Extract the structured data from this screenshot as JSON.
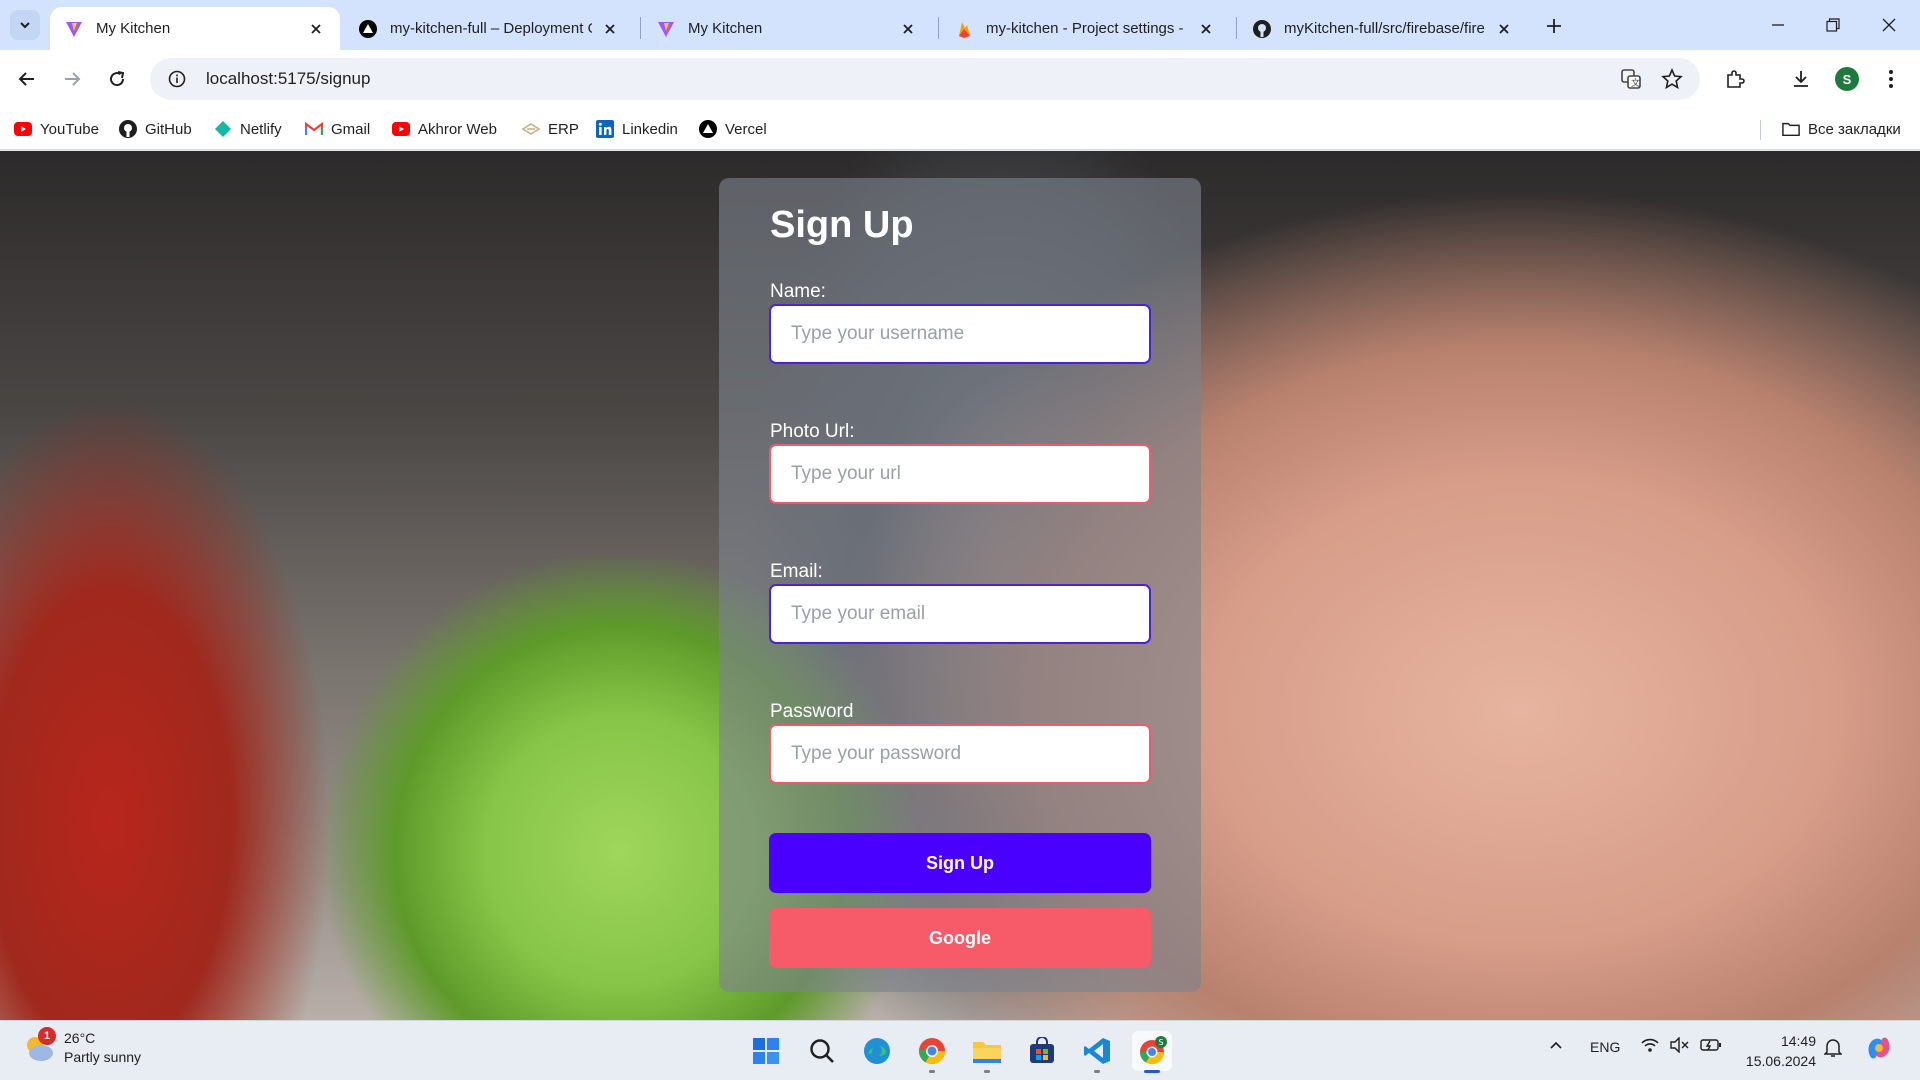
{
  "browser": {
    "tabs": [
      {
        "title": "My Kitchen",
        "favicon": "vite-icon",
        "active": true
      },
      {
        "title": "my-kitchen-full – Deployment O",
        "favicon": "vercel-icon",
        "active": false
      },
      {
        "title": "My Kitchen",
        "favicon": "vite-icon",
        "active": false
      },
      {
        "title": "my-kitchen - Project settings - F",
        "favicon": "firebase-icon",
        "active": false
      },
      {
        "title": "myKitchen-full/src/firebase/fire",
        "favicon": "github-icon",
        "active": false
      }
    ],
    "url": "localhost:5175/signup",
    "profile_initial": "S",
    "bookmarks": [
      {
        "label": "YouTube",
        "icon": "youtube-icon"
      },
      {
        "label": "GitHub",
        "icon": "github-icon"
      },
      {
        "label": "Netlify",
        "icon": "netlify-icon"
      },
      {
        "label": "Gmail",
        "icon": "gmail-icon"
      },
      {
        "label": "Akhror Web",
        "icon": "youtube-icon"
      },
      {
        "label": "ERP",
        "icon": "erp-icon"
      },
      {
        "label": "Linkedin",
        "icon": "linkedin-icon"
      },
      {
        "label": "Vercel",
        "icon": "vercel-icon"
      }
    ],
    "all_bookmarks_label": "Все закладки"
  },
  "form": {
    "title": "Sign Up",
    "name_label": "Name:",
    "name_placeholder": "Type your username",
    "photo_label": "Photo Url:",
    "photo_placeholder": "Type your url",
    "email_label": "Email:",
    "email_placeholder": "Type your email",
    "password_label": "Password",
    "password_placeholder": "Type your password",
    "submit_label": "Sign Up",
    "google_label": "Google"
  },
  "taskbar": {
    "weather_temp": "26°C",
    "weather_desc": "Partly sunny",
    "weather_badge": "1",
    "apps": [
      "start-icon",
      "search-icon",
      "edge-icon",
      "chrome-icon",
      "file-explorer-icon",
      "store-icon",
      "vscode-icon",
      "chrome-profile-icon"
    ],
    "lang": "ENG",
    "time": "14:49",
    "date": "15.06.2024"
  },
  "colors": {
    "primary_button": "#4a00ff",
    "google_button": "#f75a68",
    "tabstrip": "#d3e3fd"
  }
}
